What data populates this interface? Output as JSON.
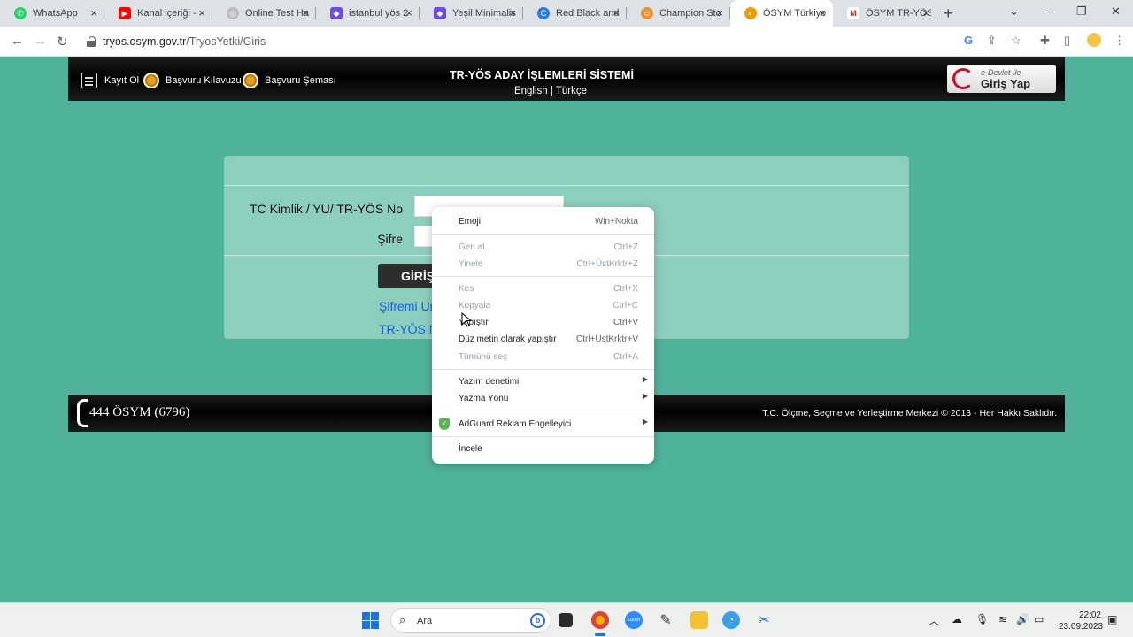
{
  "browser": {
    "tabs": [
      {
        "title": "WhatsApp",
        "icon": "whatsapp-icon"
      },
      {
        "title": "Kanal içeriği -",
        "icon": "youtube-icon"
      },
      {
        "title": "Online Test Ha",
        "icon": "globe-icon"
      },
      {
        "title": "istanbul yös 2",
        "icon": "canva-icon"
      },
      {
        "title": "Yeşil Minimalis",
        "icon": "canva-icon"
      },
      {
        "title": "Red Black and",
        "icon": "canva-c-icon"
      },
      {
        "title": "Champion Sto",
        "icon": "champion-icon"
      },
      {
        "title": "ÖSYM Türkiye",
        "icon": "osym-icon"
      },
      {
        "title": "ÖSYM TR-YÖS",
        "icon": "gmail-icon"
      }
    ],
    "active_tab": 7,
    "url_host": "tryos.osym.gov.tr",
    "url_path": "/TryosYetki/Giris"
  },
  "header": {
    "links": [
      "Kayıt Ol",
      "Başvuru Kılavuzu",
      "Başvuru Şeması"
    ],
    "title": "TR-YÖS ADAY İŞLEMLERİ SİSTEMİ",
    "lang_en": "English",
    "lang_sep": "|",
    "lang_tr": "Türkçe",
    "edevlet_line1": "e-Devlet İle",
    "edevlet_line2": "Giriş Yap"
  },
  "login": {
    "id_label": "TC Kimlik / YU/ TR-YÖS No",
    "password_label": "Şifre",
    "button_label": "GİRİŞ",
    "forgot_link": "Şifremi Unuttum",
    "number_link": "TR-YÖS No"
  },
  "footer": {
    "phone": "444 ÖSYM (6796)",
    "copyright": "T.C. Ölçme, Seçme ve Yerleştirme Merkezi © 2013 - Her Hakkı Saklıdır."
  },
  "context_menu": {
    "emoji": {
      "label": "Emoji",
      "shortcut": "Win+Nokta"
    },
    "undo": {
      "label": "Geri al",
      "shortcut": "Ctrl+Z"
    },
    "redo": {
      "label": "Yinele",
      "shortcut": "Ctrl+ÜstKrktr+Z"
    },
    "cut": {
      "label": "Kes",
      "shortcut": "Ctrl+X"
    },
    "copy": {
      "label": "Kopyala",
      "shortcut": "Ctrl+C"
    },
    "paste": {
      "label": "Yapıştır",
      "shortcut": "Ctrl+V"
    },
    "paste_plain": {
      "label": "Düz metin olarak yapıştır",
      "shortcut": "Ctrl+ÜstKrktr+V"
    },
    "select_all": {
      "label": "Tümünü seç",
      "shortcut": "Ctrl+A"
    },
    "spellcheck": "Yazım denetimi",
    "writing_direction": "Yazma Yönü",
    "adguard": "AdGuard Reklam Engelleyici",
    "inspect": "İncele"
  },
  "taskbar": {
    "search_placeholder": "Ara",
    "time": "22:02",
    "date": "23.09.2023"
  },
  "colors": {
    "page_bg": "#4fb39b",
    "panel_bg": "#8ccfbf",
    "link": "#1a5fd0",
    "accent_blue": "#1a73e8"
  }
}
